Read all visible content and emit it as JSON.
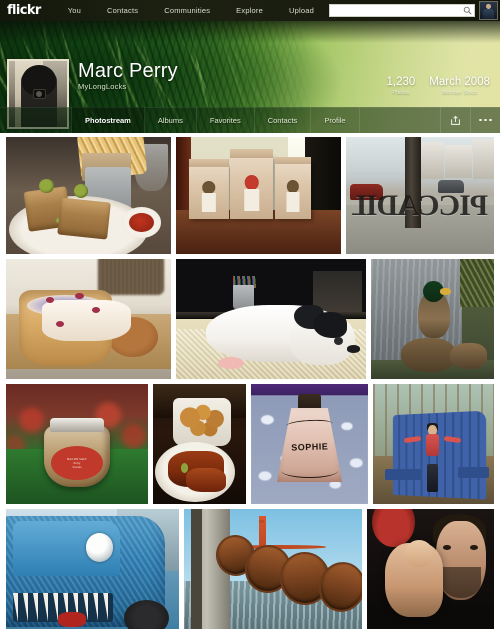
{
  "topnav": {
    "logo": "flickr",
    "links": [
      {
        "label": "You"
      },
      {
        "label": "Contacts"
      },
      {
        "label": "Communities"
      },
      {
        "label": "Explore"
      },
      {
        "label": "Upload"
      }
    ],
    "search": {
      "value": "",
      "placeholder": ""
    },
    "search_icon": "search-icon",
    "avatar_icon": "user-avatar"
  },
  "profile": {
    "display_name": "Marc Perry",
    "user_name": "MyLongLocks",
    "stats": [
      {
        "value": "1,230",
        "label": "Photos"
      },
      {
        "value": "March 2008",
        "label": "Member Since"
      }
    ]
  },
  "tabs": [
    {
      "label": "Photostream",
      "active": true
    },
    {
      "label": "Albums",
      "active": false
    },
    {
      "label": "Favorites",
      "active": false
    },
    {
      "label": "Contacts",
      "active": false
    },
    {
      "label": "Profile",
      "active": false
    }
  ],
  "tab_actions": [
    {
      "icon": "share-icon"
    },
    {
      "icon": "more-options-icon"
    }
  ],
  "grid": {
    "rows": [
      {
        "photos": [
          {
            "name": "photo-sandwich-and-fries",
            "alt": "Club sandwich with olives on a white plate beside a cone of french fries and ketchup"
          },
          {
            "name": "photo-coffee-bags",
            "alt": "Three kraft paper coffee bags with round seals on a wooden counter"
          },
          {
            "name": "photo-street-window-lettering",
            "alt": "City street seen through a window with reversed gold lettering",
            "lettering": "PICCADILLY"
          }
        ]
      },
      {
        "photos": [
          {
            "name": "photo-ice-cream-waffle-bowl",
            "alt": "Ice cream with berries served in a waffle bowl on a wooden board"
          },
          {
            "name": "photo-puppy-on-rug",
            "alt": "White and black puppy lying on a cream rug under a desk"
          },
          {
            "name": "photo-ducks-in-water",
            "alt": "Mallard drake and hens standing at the edge of shallow water"
          }
        ]
      },
      {
        "photos": [
          {
            "name": "photo-bacon-salt-jar",
            "alt": "Glass jar of bacon salt with a red label on a green tablecloth",
            "label_line1": "BACON SALT",
            "label_line2": "Perry",
            "label_line3": "Sweets"
          },
          {
            "name": "photo-bbq-plate-onion-rings",
            "alt": "Barbecue meat on a white plate with a basket of onion rings"
          },
          {
            "name": "photo-sophie-cowbell",
            "alt": "Cowbell painted with the name SOPHIE on a patterned background",
            "bell_name": "SOPHIE"
          },
          {
            "name": "photo-woman-on-blue-chair",
            "alt": "Woman with arms outstretched sitting on a large blue Adirondack bench in the woods"
          }
        ]
      },
      {
        "photos": [
          {
            "name": "photo-blue-truck-shark-teeth",
            "alt": "Weathered blue truck front painted with shark teeth"
          },
          {
            "name": "photo-rusty-chain-golden-gate",
            "alt": "Rusty anchor chain in the foreground with the Golden Gate Bridge behind"
          },
          {
            "name": "photo-man-pointing",
            "alt": "Bearded man pointing his finger directly at the camera under a red lamp"
          }
        ]
      }
    ]
  },
  "colors": {
    "nav_background": "#1b1d10",
    "banner_green_dark": "#0c2c0d",
    "banner_green_light": "#e4e4a4",
    "tab_active_text": "#ffffff",
    "page_background": "#ffffff"
  }
}
